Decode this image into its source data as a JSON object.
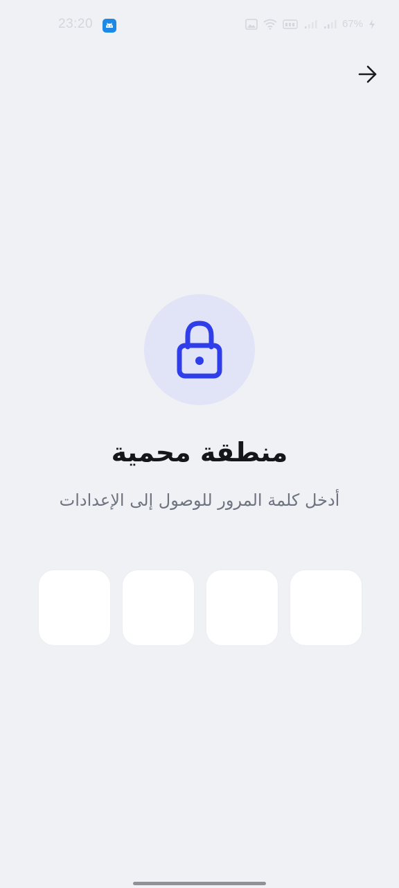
{
  "status_bar": {
    "time": "23:20",
    "battery": "67%",
    "network": "Vo LTE"
  },
  "header": {
    "back_icon": "arrow-right-icon"
  },
  "lock": {
    "icon": "lock-icon",
    "accent_color": "#2f3ee8",
    "circle_color": "#e1e3f6"
  },
  "content": {
    "title": "منطقة محمية",
    "subtitle": "أدخل كلمة المرور للوصول إلى الإعدادات"
  },
  "pin": {
    "digits": [
      "",
      "",
      "",
      ""
    ],
    "entered_count": 0
  }
}
